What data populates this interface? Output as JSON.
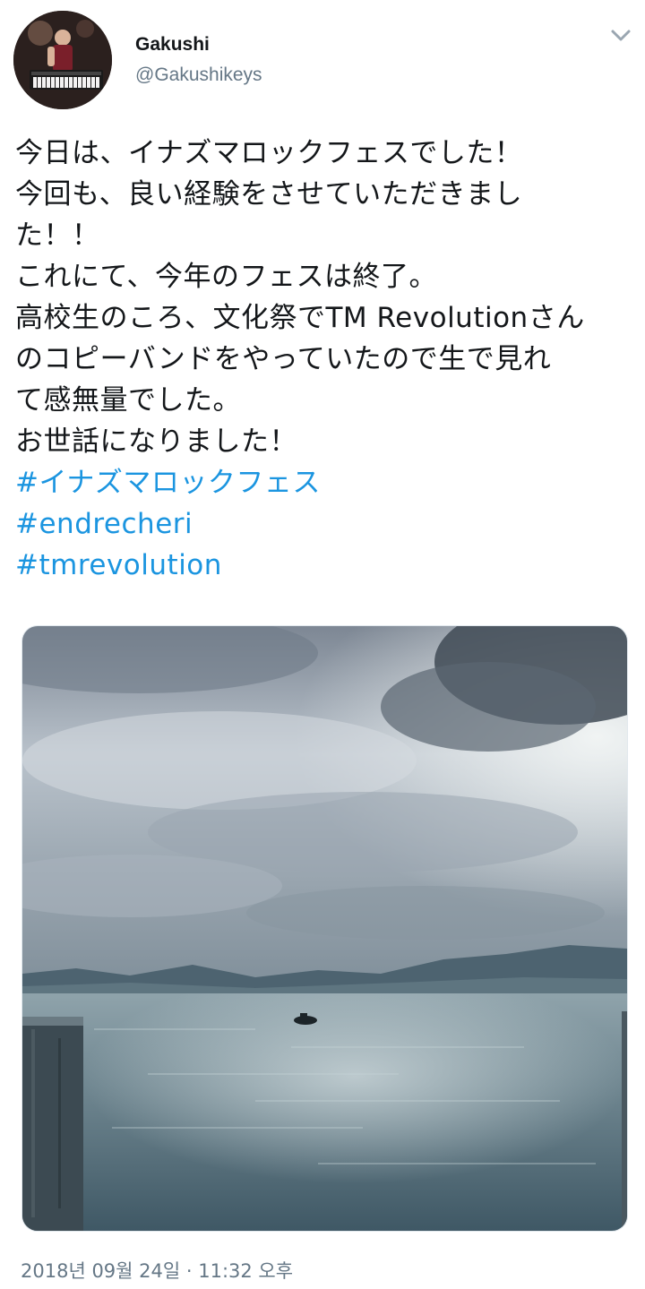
{
  "user": {
    "display_name": "Gakushi",
    "handle": "@Gakushikeys",
    "avatar_icon": "keyboardist-avatar"
  },
  "menu": {
    "icon": "chevron-down-icon"
  },
  "tweet": {
    "lines": [
      "今日は、イナズマロックフェスでした！",
      "今回も、良い経験をさせていただきまし",
      "た！！",
      "これにて、今年のフェスは終了。",
      "高校生のころ、文化祭でTM Revolutionさん",
      "のコピーバンドをやっていたので生で見れ",
      "て感無量でした。",
      "お世話になりました！"
    ],
    "hashtags": [
      "#イナズマロックフェス",
      "#endrecheri",
      "#tmrevolution"
    ]
  },
  "media": {
    "description_icon": "lake-photo"
  },
  "timestamp": "2018년 09월 24일 · 11:32 오후",
  "colors": {
    "link": "#1b95e0",
    "secondary_text": "#657786",
    "primary_text": "#14171a"
  }
}
